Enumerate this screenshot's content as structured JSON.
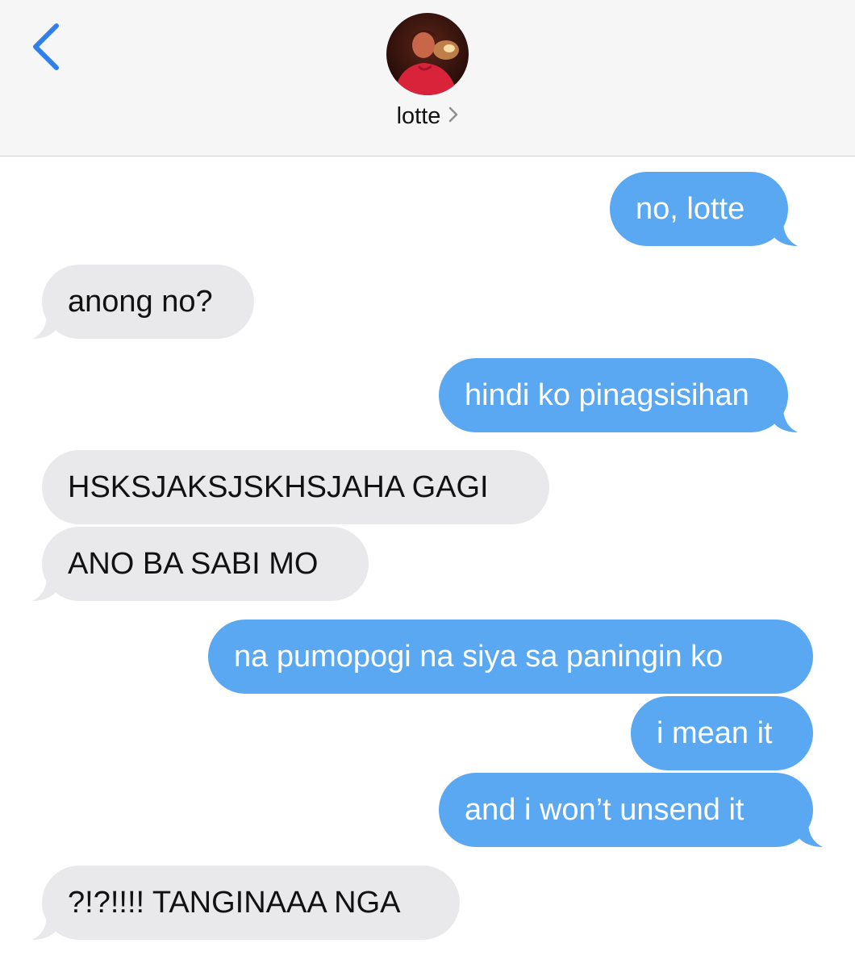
{
  "header": {
    "back_icon": "chevron-left-icon",
    "contact_name": "lotte",
    "contact_chevron": "chevron-right-icon",
    "accent_color": "#2f80ed"
  },
  "colors": {
    "sent_bubble": "#5aa8f1",
    "received_bubble": "#e9e9eb"
  },
  "messages": [
    {
      "direction": "sent",
      "text": "no, lotte"
    },
    {
      "direction": "received",
      "text": "anong no?"
    },
    {
      "direction": "sent",
      "text": "hindi ko pinagsisihan"
    },
    {
      "direction": "received",
      "text": "HSKSJAKSJSKHSJAHA GAGI"
    },
    {
      "direction": "received",
      "text": "ANO BA SABI MO"
    },
    {
      "direction": "sent",
      "text": "na pumopogi na siya sa paningin ko"
    },
    {
      "direction": "sent",
      "text": "i mean it"
    },
    {
      "direction": "sent",
      "text": "and i won’t unsend it"
    },
    {
      "direction": "received",
      "text": "?!?!!!! TANGINAAA NGA"
    }
  ]
}
